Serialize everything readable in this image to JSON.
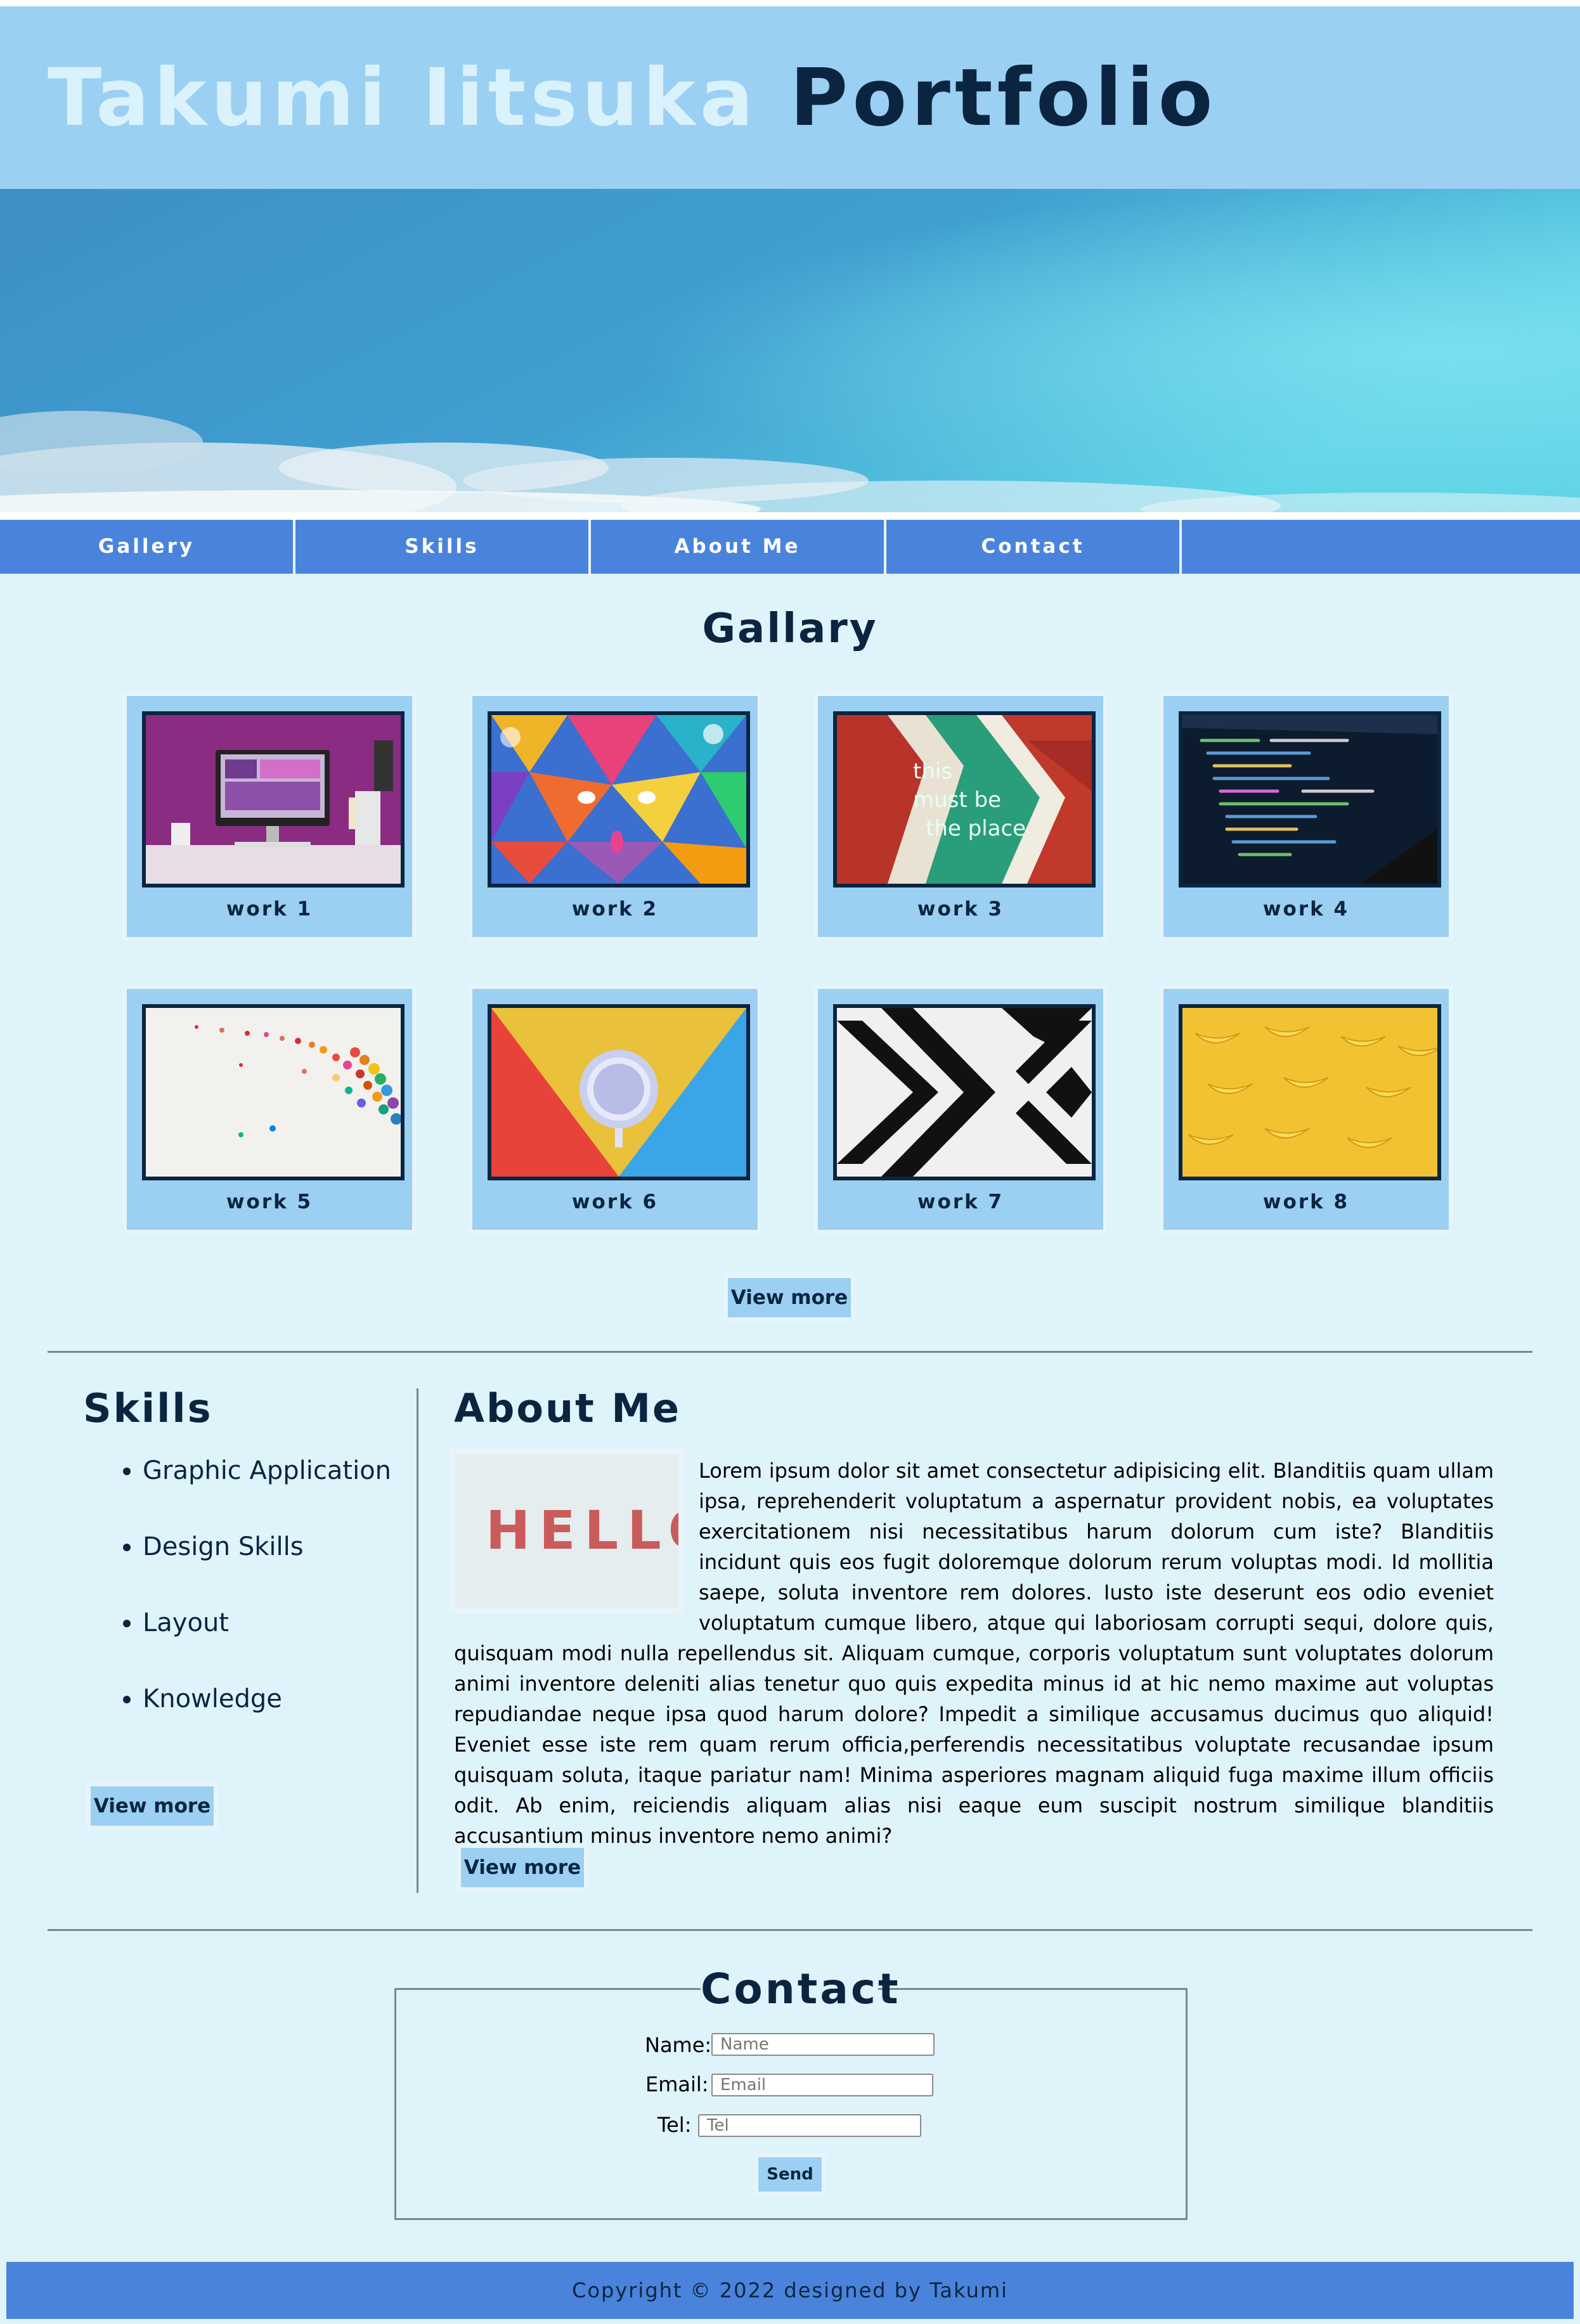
{
  "header": {
    "title_name": "Takumi Iitsuka",
    "title_portfolio": "Portfolio"
  },
  "nav": {
    "items": [
      {
        "label": "Gallery"
      },
      {
        "label": "Skills"
      },
      {
        "label": "About Me"
      },
      {
        "label": "Contact"
      }
    ]
  },
  "gallery": {
    "title": "Gallary",
    "works": [
      {
        "label": "work 1"
      },
      {
        "label": "work 2"
      },
      {
        "label": "work 3"
      },
      {
        "label": "work 4"
      },
      {
        "label": "work 5"
      },
      {
        "label": "work 6"
      },
      {
        "label": "work 7"
      },
      {
        "label": "work 8"
      }
    ],
    "thumb_text": "this must be the place",
    "view_more": "View more"
  },
  "skills": {
    "title": "Skills",
    "items": [
      {
        "label": "Graphic Application"
      },
      {
        "label": "Design Skills"
      },
      {
        "label": "Layout"
      },
      {
        "label": "Knowledge"
      }
    ],
    "view_more": "View more"
  },
  "about": {
    "title": "About Me",
    "image_text": "HELLO",
    "paragraph": "Lorem ipsum dolor sit amet consectetur adipisicing elit. Blanditiis quam ullam ipsa, reprehenderit voluptatum a aspernatur provident nobis, ea voluptates exercitationem nisi necessitatibus harum dolorum cum iste? Blanditiis incidunt quis eos fugit doloremque dolorum rerum voluptas modi. Id mollitia saepe, soluta inventore rem dolores. Iusto iste deserunt eos odio eveniet voluptatum cumque libero, atque qui laboriosam corrupti sequi, dolore quis, quisquam modi nulla repellendus sit. Aliquam cumque, corporis voluptatum sunt voluptates dolorum animi inventore deleniti alias tenetur quo quis expedita minus id at hic nemo maxime aut voluptas repudiandae neque ipsa quod harum dolore? Impedit a similique accusamus ducimus quo aliquid! Eveniet esse iste rem quam rerum officia,perferendis necessitatibus voluptate recusandae ipsum quisquam soluta, itaque pariatur nam! Minima asperiores magnam aliquid fuga maxime illum officiis odit. Ab enim, reiciendis aliquam alias nisi eaque eum suscipit nostrum similique blanditiis accusantium minus inventore nemo animi?",
    "view_more": "View more"
  },
  "contact": {
    "title": "Contact",
    "name_label": "Name:",
    "name_placeholder": "Name",
    "email_label": "Email:",
    "email_placeholder": "Email",
    "tel_label": "Tel:",
    "tel_placeholder": "Tel",
    "send": "Send"
  },
  "footer": {
    "copyright": "Copyright © 2022 designed by Takumi"
  },
  "colors": {
    "header_bg": "#9bd0f3",
    "nav_bg": "#4a83db",
    "page_bg": "#dff3fb",
    "text_dark": "#0b2540",
    "title_light": "#d9f2fb"
  }
}
